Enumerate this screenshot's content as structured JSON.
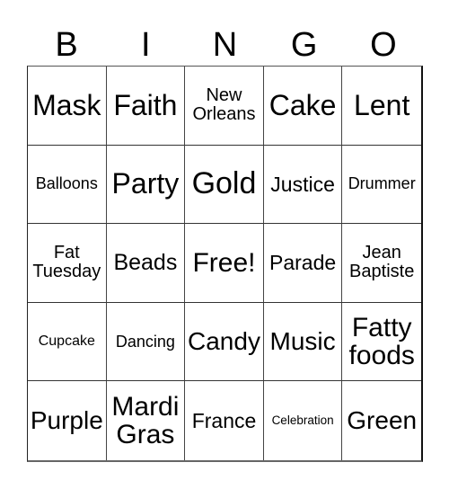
{
  "header": [
    "B",
    "I",
    "N",
    "G",
    "O"
  ],
  "cells": [
    "Mask",
    "Faith",
    "New Orleans",
    "Cake",
    "Lent",
    "Balloons",
    "Party",
    "Gold",
    "Justice",
    "Drummer",
    "Fat Tuesday",
    "Beads",
    "Free!",
    "Parade",
    "Jean Baptiste",
    "Cupcake",
    "Dancing",
    "Candy",
    "Music",
    "Fatty foods",
    "Purple",
    "Mardi Gras",
    "France",
    "Celebration",
    "Green"
  ]
}
